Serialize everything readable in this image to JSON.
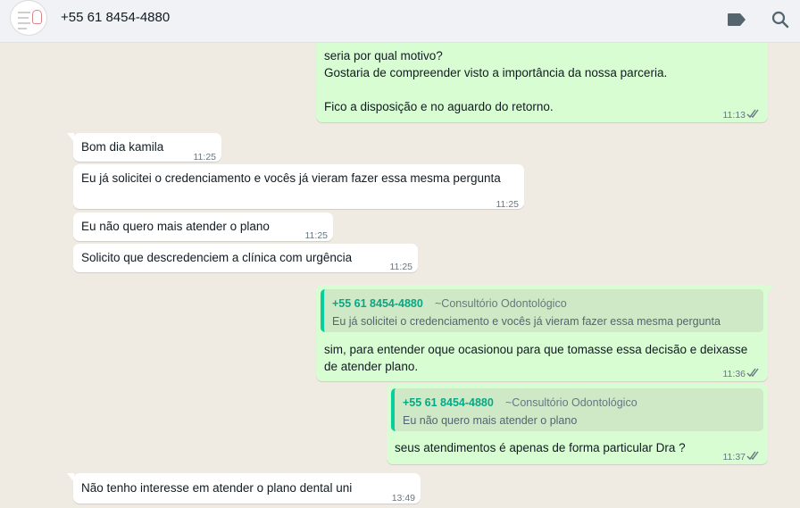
{
  "header": {
    "contact_name": "+55 61 8454-4880",
    "icons": [
      "label-icon",
      "search-icon"
    ]
  },
  "colors": {
    "incoming_bubble": "#ffffff",
    "outgoing_bubble": "#d9fdd3",
    "quote_name": "#06a884",
    "tick_read": "#667781"
  },
  "messages": [
    {
      "direction": "out",
      "lines": [
        "seria por qual motivo?",
        "Gostaria de compreender visto a importância da nossa parceria.",
        "",
        "Fico a disposição e no aguardo do retorno."
      ],
      "time": "11:13"
    },
    {
      "direction": "in",
      "text": "Bom dia kamila",
      "time": "11:25"
    },
    {
      "direction": "in",
      "text": "Eu já solicitei o credenciamento e vocês já vieram fazer essa mesma pergunta",
      "time": "11:25"
    },
    {
      "direction": "in",
      "text": "Eu não quero mais atender o plano",
      "time": "11:25"
    },
    {
      "direction": "in",
      "text": "Solicito que descredenciem a clínica com urgência",
      "time": "11:25"
    },
    {
      "direction": "out",
      "quote": {
        "name": "+55 61 8454-4880",
        "sub": "~Consultório Odontológico",
        "text": "Eu já solicitei o credenciamento e vocês já vieram fazer essa mesma pergunta"
      },
      "lines": [
        "sim, para entender oque ocasionou para que tomasse essa decisão e deixasse",
        "de atender plano."
      ],
      "time": "11:36"
    },
    {
      "direction": "out",
      "quote": {
        "name": "+55 61 8454-4880",
        "sub": "~Consultório Odontológico",
        "text": "Eu não quero mais atender o plano"
      },
      "lines": [
        "seus atendimentos é apenas de forma particular Dra ?"
      ],
      "time": "11:37"
    },
    {
      "direction": "in",
      "text": "Não tenho interesse em atender o plano dental uni",
      "time": "13:49"
    }
  ]
}
